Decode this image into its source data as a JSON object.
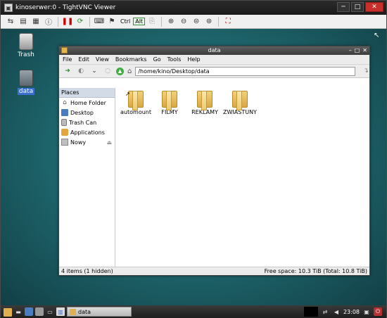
{
  "vnc": {
    "title": "kinoserwer:0 - TightVNC Viewer",
    "toolbar": {
      "ctrl": "Ctrl",
      "alt": "Alt"
    },
    "controls": {
      "minimize": "─",
      "maximize": "□",
      "close": "✕"
    }
  },
  "desktop": {
    "icons": [
      {
        "label": "Trash",
        "icon": "trash-icon"
      },
      {
        "label": "data",
        "icon": "drive-icon"
      }
    ]
  },
  "file_manager": {
    "title": "data",
    "menu": [
      "File",
      "Edit",
      "View",
      "Bookmarks",
      "Go",
      "Tools",
      "Help"
    ],
    "location": "/home/kino/Desktop/data",
    "places_header": "Places",
    "places": [
      "Home Folder",
      "Desktop",
      "Trash Can",
      "Applications",
      "Nowy"
    ],
    "folders": [
      "automount",
      "FILMY",
      "REKLAMY",
      "ZWIASTUNY"
    ],
    "status_left": "4 items (1 hidden)",
    "status_right": "Free space: 10.3 TiB (Total: 10.8 TiB)"
  },
  "taskbar": {
    "window_label": "data",
    "time": "23:08"
  }
}
